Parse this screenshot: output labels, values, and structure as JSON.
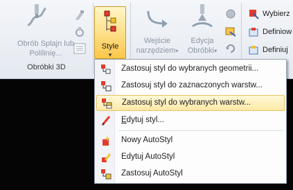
{
  "ribbon": {
    "group_obrobki3d": {
      "label": "Obróbki 3D",
      "btn_obrob_line1": "Obrób Splajn lub",
      "btn_obrob_line2": "Polilinię..."
    },
    "style_button": {
      "label": "Style",
      "arrow": "▾"
    },
    "wejscie": {
      "line1": "Wejście",
      "line2": "narzędziem",
      "arrow": "▾"
    },
    "edycja": {
      "line1": "Edycja",
      "line2": "Obróbki",
      "arrow": "▾"
    },
    "right_items": [
      "Wybierz",
      "Definiow",
      "Definiuj"
    ]
  },
  "menu": {
    "items": [
      {
        "label": "Zastosuj styl do wybranych geometrii...",
        "icon": "apply-style-geometry-icon"
      },
      {
        "label": "Zastosuj styl do zaznaczonych warstw...",
        "icon": "apply-style-selected-layers-icon"
      },
      {
        "label": "Zastosuj styl do wybranych warstw...",
        "icon": "apply-style-layers-icon",
        "highlighted": true
      },
      {
        "label": "Edytuj styl...",
        "icon": "edit-style-icon"
      },
      {
        "label": "Nowy AutoStyl",
        "icon": "new-autostyle-icon"
      },
      {
        "label": "Edytuj AutoStyl",
        "icon": "edit-autostyle-icon"
      },
      {
        "label": "Zastosuj AutoStyl",
        "icon": "apply-autostyle-icon"
      }
    ]
  },
  "colors": {
    "highlight": "#fde9a6",
    "ribbon_bg": "#e8edf3",
    "disabled_text": "#8d96a3"
  }
}
